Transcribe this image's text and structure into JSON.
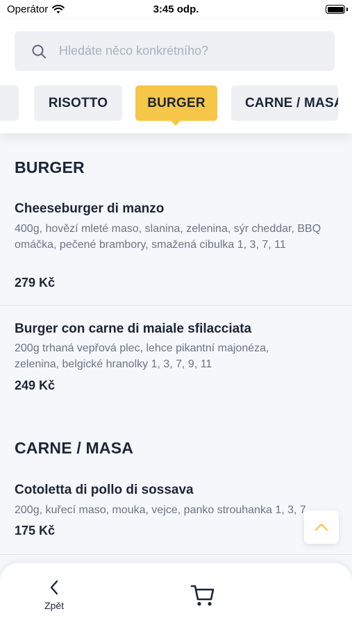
{
  "status_bar": {
    "carrier": "Operátor",
    "time": "3:45 odp.",
    "icons": [
      "wifi-icon",
      "battery-icon"
    ]
  },
  "search": {
    "placeholder": "Hledáte něco konkrétního?",
    "value": ""
  },
  "categories": {
    "items": [
      "",
      "RISOTTO",
      "BURGER",
      "CARNE / MASA"
    ],
    "active": "BURGER",
    "active_color": "#f6c648"
  },
  "sections": [
    {
      "title": "BURGER",
      "items": [
        {
          "name": "Cheeseburger di manzo",
          "description": "400g, hovězí mleté maso, slanina, zelenina, sýr cheddar, BBQ omáčka, pečené brambory, smažená cibulka 1, 3, 7, 11",
          "price": "279 Kč"
        },
        {
          "name": "Burger con carne di maiale sfilacciata",
          "description": "200g trhaná vepřová plec, lehce pikantní majonéza, zelenina, belgické hranolky 1, 3, 7, 9, 11",
          "price": "249 Kč"
        }
      ]
    },
    {
      "title": "CARNE / MASA",
      "items": [
        {
          "name": "Cotoletta di pollo di sossava",
          "description": "200g, kuřecí maso, mouka, vejce, panko strouhanka 1, 3, 7",
          "price": "175 Kč"
        }
      ]
    }
  ],
  "scroll_top": {
    "icon": "chevron-up-icon",
    "color": "#f6c648"
  },
  "bottom_bar": {
    "back_label": "Zpět",
    "back_icon": "chevron-left-icon",
    "cart_icon": "cart-icon"
  }
}
